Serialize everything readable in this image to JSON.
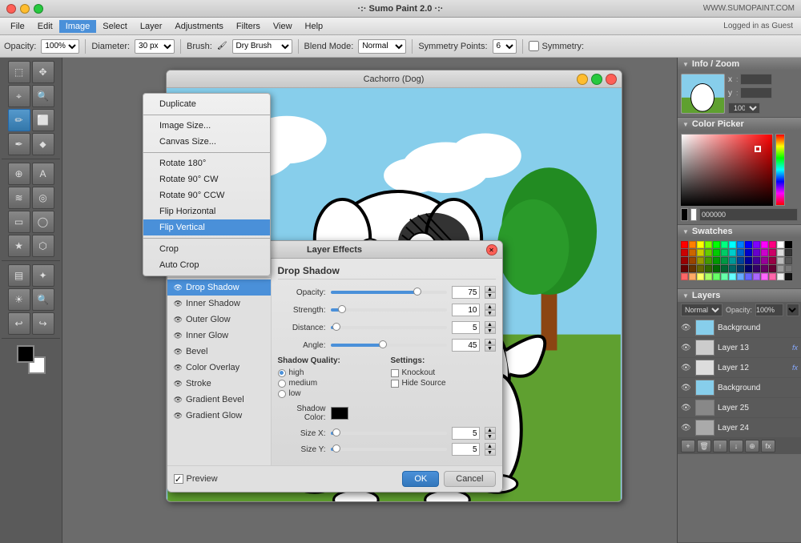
{
  "app": {
    "title": "·:· Sumo Paint 2.0 ·:·",
    "website": "WWW.SUMOPAINT.COM",
    "logged_in": "Logged in as Guest"
  },
  "menu": {
    "items": [
      "File",
      "Edit",
      "Image",
      "Select",
      "Layer",
      "Adjustments",
      "Filters",
      "View",
      "Help"
    ]
  },
  "image_menu_active": "Image",
  "toolbar": {
    "opacity_label": "Opacity:",
    "opacity_value": "100%",
    "diameter_label": "Diameter:",
    "diameter_value": "30 px",
    "brush_label": "Brush:",
    "brush_value": "Dry Brush",
    "blend_mode_label": "Blend Mode:",
    "blend_mode_value": "Normal",
    "symmetry_points_label": "Symmetry Points:",
    "symmetry_points_value": "6",
    "symmetry_label": "Symmetry:"
  },
  "canvas": {
    "title": "Cachorro (Dog)"
  },
  "image_dropdown": {
    "items": [
      {
        "label": "Duplicate",
        "type": "item"
      },
      {
        "label": "",
        "type": "separator"
      },
      {
        "label": "Image Size...",
        "type": "item"
      },
      {
        "label": "Canvas Size...",
        "type": "item"
      },
      {
        "label": "",
        "type": "separator"
      },
      {
        "label": "Rotate 180°",
        "type": "item"
      },
      {
        "label": "Rotate 90° CW",
        "type": "item"
      },
      {
        "label": "Rotate 90° CCW",
        "type": "item"
      },
      {
        "label": "Flip Horizontal",
        "type": "item"
      },
      {
        "label": "Flip Vertical",
        "type": "item",
        "highlighted": true
      },
      {
        "label": "",
        "type": "separator"
      },
      {
        "label": "Crop",
        "type": "item"
      },
      {
        "label": "Auto Crop",
        "type": "item"
      }
    ]
  },
  "layer_effects": {
    "title": "Layer Effects",
    "active_section": "Drop Shadow",
    "effects": [
      {
        "name": "Drop Shadow",
        "selected": true
      },
      {
        "name": "Inner Shadow"
      },
      {
        "name": "Outer Glow"
      },
      {
        "name": "Inner Glow"
      },
      {
        "name": "Bevel"
      },
      {
        "name": "Color Overlay"
      },
      {
        "name": "Stroke"
      },
      {
        "name": "Gradient Bevel"
      },
      {
        "name": "Gradient Glow"
      }
    ],
    "drop_shadow": {
      "opacity_label": "Opacity:",
      "opacity_value": "75",
      "strength_label": "Strength:",
      "strength_value": "10",
      "distance_label": "Distance:",
      "distance_value": "5",
      "angle_label": "Angle:",
      "angle_value": "45",
      "shadow_quality_label": "Shadow Quality:",
      "quality_options": [
        "high",
        "medium",
        "low"
      ],
      "quality_selected": "high",
      "settings_label": "Settings:",
      "knockout_label": "Knockout",
      "hide_source_label": "Hide Source",
      "shadow_color_label": "Shadow Color:",
      "size_x_label": "Size X:",
      "size_x_value": "5",
      "size_y_label": "Size Y:",
      "size_y_value": "5"
    },
    "preview_label": "Preview",
    "ok_label": "OK",
    "cancel_label": "Cancel"
  },
  "right_panel": {
    "info_zoom": {
      "title": "Info / Zoom",
      "x_label": "x",
      "y_label": "y",
      "zoom_value": "100 %"
    },
    "color_picker": {
      "title": "Color Picker",
      "hex_value": "000000"
    },
    "swatches": {
      "title": "Swatches",
      "colors": [
        "#ff0000",
        "#ff8000",
        "#ffff00",
        "#80ff00",
        "#00ff00",
        "#00ff80",
        "#00ffff",
        "#0080ff",
        "#0000ff",
        "#8000ff",
        "#ff00ff",
        "#ff0080",
        "#ffffff",
        "#000000",
        "#cc0000",
        "#cc6600",
        "#cccc00",
        "#66cc00",
        "#00cc00",
        "#00cc66",
        "#00cccc",
        "#0066cc",
        "#0000cc",
        "#6600cc",
        "#cc00cc",
        "#cc0066",
        "#dddddd",
        "#333333",
        "#990000",
        "#994400",
        "#999900",
        "#449900",
        "#009900",
        "#009944",
        "#009999",
        "#004499",
        "#000099",
        "#440099",
        "#990099",
        "#990044",
        "#bbbbbb",
        "#555555",
        "#660000",
        "#663300",
        "#666600",
        "#336600",
        "#006600",
        "#006633",
        "#006666",
        "#003366",
        "#000066",
        "#330066",
        "#660066",
        "#660033",
        "#999999",
        "#777777",
        "#ff6666",
        "#ffaa66",
        "#ffff66",
        "#aaff66",
        "#66ff66",
        "#66ffaa",
        "#66ffff",
        "#66aaff",
        "#6666ff",
        "#aa66ff",
        "#ff66ff",
        "#ff66aa",
        "#eeeeee",
        "#111111"
      ]
    },
    "layers": {
      "title": "Layers",
      "blend_mode": "Normal",
      "opacity_label": "Opacity:",
      "opacity_value": "100%",
      "items": [
        {
          "name": "Background",
          "has_fx": false,
          "thumb_color": "#87ceeb"
        },
        {
          "name": "Layer 13",
          "has_fx": true,
          "thumb_color": "#ccc"
        },
        {
          "name": "Layer 12",
          "has_fx": true,
          "thumb_color": "#ddd"
        },
        {
          "name": "Background",
          "has_fx": false,
          "thumb_color": "#87ceeb"
        },
        {
          "name": "Layer 25",
          "has_fx": false,
          "thumb_color": "#888"
        },
        {
          "name": "Layer 24",
          "has_fx": false,
          "thumb_color": "#aaa"
        }
      ]
    }
  },
  "tools": {
    "icons": [
      "↖",
      "↗",
      "✂",
      "⊕",
      "✏",
      "✒",
      "🖌",
      "⬛",
      "◯",
      "△",
      "☆",
      "✦",
      "☰",
      "A",
      "⚡",
      "⛔",
      "↩",
      "↪",
      "◼",
      "◻"
    ]
  }
}
